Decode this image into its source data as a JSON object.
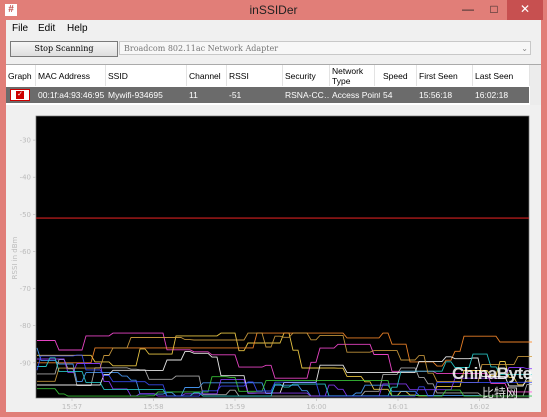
{
  "window": {
    "title": "inSSIDer",
    "app_icon_glyph": "#"
  },
  "menu": [
    "File",
    "Edit",
    "Help"
  ],
  "toolbar": {
    "scan_button": "Stop Scanning",
    "adapter": "Broadcom 802.11ac Network Adapter"
  },
  "table": {
    "columns": [
      "Graph",
      "MAC Address",
      "SSID",
      "Channel",
      "RSSI",
      "Security",
      "Network Type",
      "Speed",
      "First Seen",
      "Last Seen"
    ],
    "row": {
      "graph_checked": true,
      "mac": "00:1f:a4:93:46:95",
      "ssid": "Mywifi-934695",
      "channel": "11",
      "rssi": "-51",
      "security": "RSNA-CC…",
      "network_type": "Access Point",
      "speed": "54",
      "first_seen": "15:56:18",
      "last_seen": "16:02:18"
    }
  },
  "chart_data": {
    "type": "line",
    "ylabel": "RSSI in dBm",
    "ylim": [
      -100,
      -20
    ],
    "yticks": [
      "-30",
      "-40",
      "-50",
      "-60",
      "-70",
      "-80",
      "-90"
    ],
    "xticks": [
      "15:57",
      "15:58",
      "15:59",
      "16:00",
      "16:01",
      "16:02"
    ],
    "highlight_series": {
      "ssid": "Mywifi-934695",
      "rssi": -51,
      "color": "#d22020"
    },
    "other_series_colors": [
      "#ff4ad8",
      "#ffd84a",
      "#ff8c2a",
      "#4aa0ff",
      "#b6b6b6",
      "#ffffff",
      "#8c3cff",
      "#3cd23c",
      "#2ad2d2",
      "#d2a040",
      "#3c50ff"
    ]
  },
  "watermark": {
    "brand": "ChinaByte",
    "subtitle": "比特网"
  }
}
